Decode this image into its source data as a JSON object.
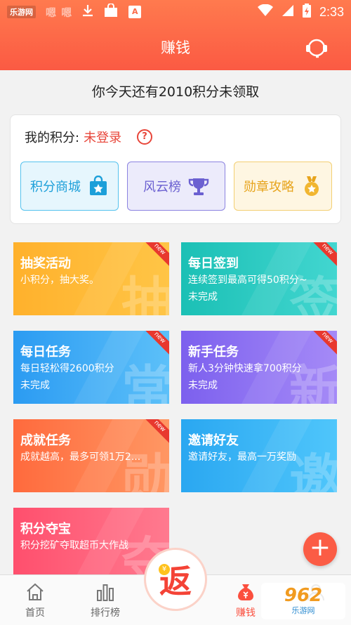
{
  "status_bar": {
    "watermark": "乐游网",
    "blurred_text": "嗯 嗯",
    "download_icon": "download-icon",
    "bag_icon": "shopping-bag-icon",
    "app_badge": "A",
    "time": "2:33"
  },
  "header": {
    "title": "赚钱"
  },
  "notice": "你今天还有2010积分未领取",
  "points": {
    "label": "我的积分:",
    "status": "未登录",
    "help": "?"
  },
  "quick_links": [
    {
      "label": "积分商城",
      "icon": "shopping-bag-star-icon"
    },
    {
      "label": "风云榜",
      "icon": "trophy-icon"
    },
    {
      "label": "勋章攻略",
      "icon": "medal-icon"
    }
  ],
  "tasks": [
    {
      "title": "抽奖活动",
      "sub": "小积分，抽大奖。",
      "status": "",
      "bg": "抽",
      "new": "new"
    },
    {
      "title": "每日签到",
      "sub": "连续签到最高可得50积分~",
      "status": "未完成",
      "bg": "签",
      "new": "new"
    },
    {
      "title": "每日任务",
      "sub": "每日轻松得2600积分",
      "status": "未完成",
      "bg": "常",
      "new": "new"
    },
    {
      "title": "新手任务",
      "sub": "新人3分钟快速拿700积分",
      "status": "未完成",
      "bg": "新",
      "new": "new"
    },
    {
      "title": "成就任务",
      "sub": "成就越高，最多可领1万2...",
      "status": "",
      "bg": "勋",
      "new": "new"
    },
    {
      "title": "邀请好友",
      "sub": "邀请好友，最高一万奖励",
      "status": "",
      "bg": "邀",
      "new": ""
    },
    {
      "title": "积分夺宝",
      "sub": "积分挖矿夺取超币大作战",
      "status": "",
      "bg": "夺",
      "new": ""
    }
  ],
  "fab": "+",
  "nav": {
    "home": "首页",
    "rank": "排行榜",
    "center": "返",
    "center_coin": "¥",
    "earn": "赚钱"
  },
  "site_logo": {
    "num": "962",
    "sub": "乐游网"
  },
  "colors": {
    "accent": "#fb5a43",
    "red_text": "#e8463a"
  }
}
